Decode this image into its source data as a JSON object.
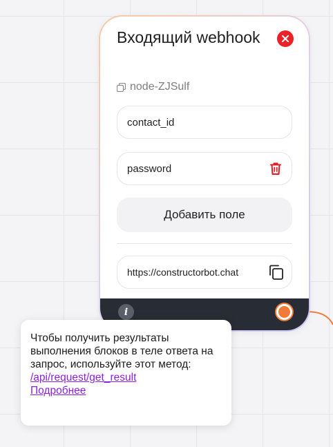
{
  "node": {
    "title": "Входящий webhook",
    "id": "node-ZJSulf",
    "fields": [
      {
        "value": "contact_id",
        "deletable": false
      },
      {
        "value": "password",
        "deletable": true
      }
    ],
    "add_field_label": "Добавить поле",
    "url": "https://constructorbot.chat"
  },
  "tooltip": {
    "text": "Чтобы получить результаты выполнения блоков в теле ответа на запрос, используйте этот метод:",
    "method_link": "/api/request/get_result",
    "more_link": "Подробнее"
  },
  "colors": {
    "accent": "#f07a37",
    "danger": "#ea2227",
    "link": "#8a1ee6",
    "footer": "#282c35"
  },
  "icons": [
    "close-icon",
    "copy-icon",
    "trash-icon",
    "info-icon"
  ]
}
